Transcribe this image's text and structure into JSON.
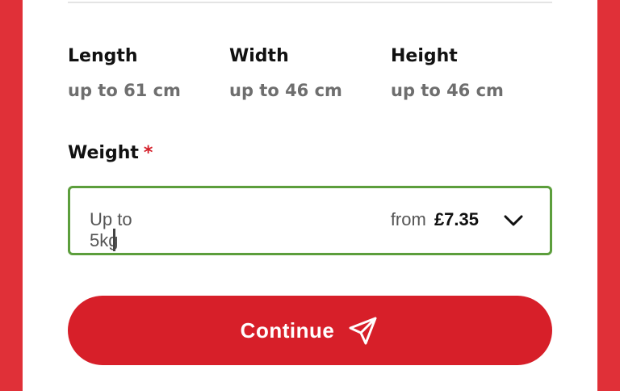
{
  "dimensions": [
    {
      "label": "Length",
      "value": "up to 61 cm"
    },
    {
      "label": "Width",
      "value": "up to 46 cm"
    },
    {
      "label": "Height",
      "value": "up to 46 cm"
    }
  ],
  "weight": {
    "label": "Weight",
    "required_marker": "*",
    "selected": "Up to 5kg",
    "price_prefix": "from",
    "price": "£7.35"
  },
  "continue_button": {
    "label": "Continue"
  },
  "colors": {
    "page_background": "#e03038",
    "button": "#d71f29",
    "select_border": "#5c9e3c",
    "required": "#d41f29"
  },
  "icons": {
    "dropdown": "chevron-down-icon",
    "continue": "send-icon"
  }
}
